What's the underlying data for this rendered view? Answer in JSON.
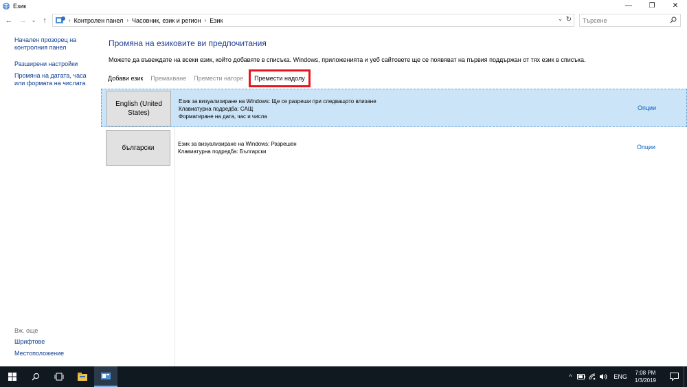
{
  "window": {
    "title": "Език",
    "minimize": "—",
    "maximize": "❐",
    "close": "✕"
  },
  "address": {
    "crumbs": [
      "Контролен панел",
      "Часовник, език и регион",
      "Език"
    ],
    "search_placeholder": "Търсене"
  },
  "sidebar": {
    "links": [
      "Начален прозорец на контролния панел",
      "Разширени настройки",
      "Промяна на датата, часа или формата на числата"
    ],
    "see_also_label": "Вж. още",
    "see_also": [
      "Шрифтове",
      "Местоположение"
    ]
  },
  "main": {
    "heading": "Промяна на езиковите ви предпочитания",
    "description": "Можете да въвеждате на всеки език, който добавяте в списъка. Windows, приложенията и уеб сайтовете ще се появяват на първия поддържан от тях език в списъка.",
    "toolbar": {
      "add": "Добави език",
      "remove": "Премахване",
      "move_up": "Премести нагоре",
      "move_down": "Премести надолу"
    },
    "languages": [
      {
        "name": "English (United States)",
        "display": "Език за визуализиране на Windows:  Ще се разреши при следващото влизане",
        "keyboard": "Клавиатурна подредба: САЩ",
        "format": "Форматиране на дата, час и числа",
        "options": "Опции",
        "selected": true
      },
      {
        "name": "български",
        "display": "Език за визуализиране на Windows:  Разрешен",
        "keyboard": "Клавиатурна подредба: Български",
        "options": "Опции",
        "selected": false
      }
    ]
  },
  "taskbar": {
    "language": "ENG",
    "time": "7:08 PM",
    "date": "1/3/2019"
  },
  "colors": {
    "link": "#0b3c8f",
    "heading": "#1e3d8f",
    "selection": "#cce4f7",
    "highlight_box": "#e8141b",
    "taskbar": "#101820"
  }
}
